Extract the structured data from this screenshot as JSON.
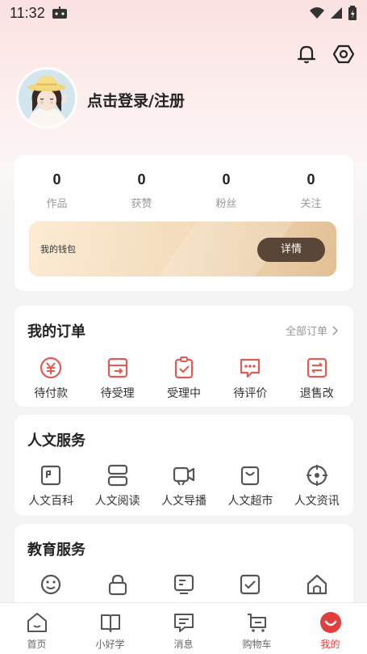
{
  "status": {
    "time": "11:32"
  },
  "profile": {
    "login_text": "点击登录/注册"
  },
  "stats": [
    {
      "value": "0",
      "label": "作品"
    },
    {
      "value": "0",
      "label": "获赞"
    },
    {
      "value": "0",
      "label": "粉丝"
    },
    {
      "value": "0",
      "label": "关注"
    }
  ],
  "wallet": {
    "label": "我的钱包",
    "button": "详情"
  },
  "orders": {
    "title": "我的订单",
    "all_label": "全部订单",
    "items": [
      {
        "label": "待付款",
        "icon": "yuan-clock-icon"
      },
      {
        "label": "待受理",
        "icon": "box-arrow-icon"
      },
      {
        "label": "受理中",
        "icon": "clipboard-check-icon"
      },
      {
        "label": "待评价",
        "icon": "comment-dots-icon"
      },
      {
        "label": "退售改",
        "icon": "exchange-icon"
      }
    ]
  },
  "culture": {
    "title": "人文服务",
    "items": [
      {
        "label": "人文百科",
        "icon": "encyclopedia-icon"
      },
      {
        "label": "人文阅读",
        "icon": "stack-icon"
      },
      {
        "label": "人文导播",
        "icon": "video-camera-icon"
      },
      {
        "label": "人文超市",
        "icon": "shopping-bag-icon"
      },
      {
        "label": "人文资讯",
        "icon": "news-icon"
      }
    ]
  },
  "education": {
    "title": "教育服务",
    "items": [
      {
        "label": "",
        "icon": "smile-icon"
      },
      {
        "label": "",
        "icon": "lock-icon"
      },
      {
        "label": "",
        "icon": "board-icon"
      },
      {
        "label": "",
        "icon": "checkbox-icon"
      },
      {
        "label": "",
        "icon": "house-icon"
      }
    ]
  },
  "nav": [
    {
      "label": "首页",
      "icon": "home-icon",
      "active": false
    },
    {
      "label": "小好学",
      "icon": "book-icon",
      "active": false
    },
    {
      "label": "消息",
      "icon": "message-icon",
      "active": false
    },
    {
      "label": "购物车",
      "icon": "cart-icon",
      "active": false
    },
    {
      "label": "我的",
      "icon": "profile-smile-icon",
      "active": true
    }
  ],
  "colors": {
    "accent": "#e33e3e",
    "wallet_button": "#5a4539",
    "icon_red": "#e35a55"
  }
}
